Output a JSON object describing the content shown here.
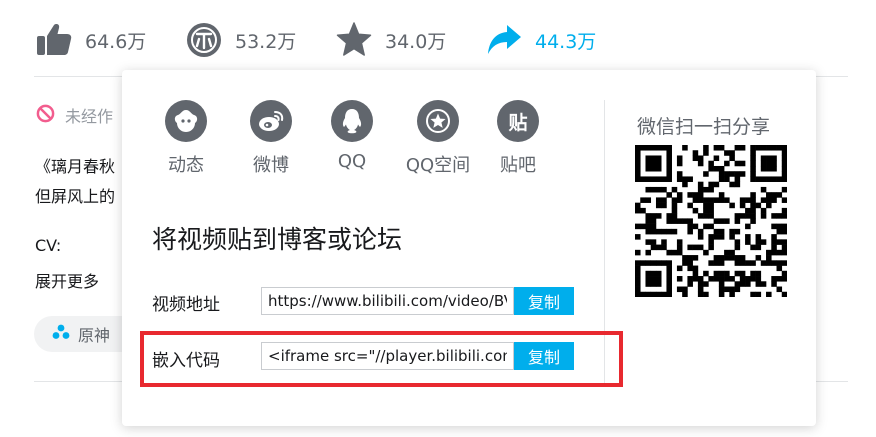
{
  "actions": {
    "like_count": "64.6万",
    "coin_count": "53.2万",
    "favorite_count": "34.0万",
    "share_count": "44.3万"
  },
  "video_info": {
    "copyright_notice": "未经作",
    "desc_line1": "《璃月春秋",
    "desc_line2": "但屏风上的",
    "cv_label": "CV:",
    "expand_label": "展开更多",
    "tag_label": "原神"
  },
  "share_popup": {
    "platforms": [
      {
        "label": "动态",
        "icon": "dynamic-icon"
      },
      {
        "label": "微博",
        "icon": "weibo-icon"
      },
      {
        "label": "QQ",
        "icon": "qq-icon"
      },
      {
        "label": "QQ空间",
        "icon": "qzone-icon"
      },
      {
        "label": "贴吧",
        "icon": "tieba-icon"
      }
    ],
    "tieba_glyph": "贴",
    "embed_title": "将视频贴到博客或论坛",
    "video_url_label": "视频地址",
    "video_url_value": "https://www.bilibili.com/video/BV",
    "embed_code_label": "嵌入代码",
    "embed_code_value": "<iframe src=\"//player.bilibili.com/player.html",
    "copy_label": "复制",
    "wechat_title": "微信扫一扫分享"
  },
  "colors": {
    "accent": "#00aeec",
    "icon_gray": "#61666d",
    "highlight_red": "#e8292f"
  }
}
